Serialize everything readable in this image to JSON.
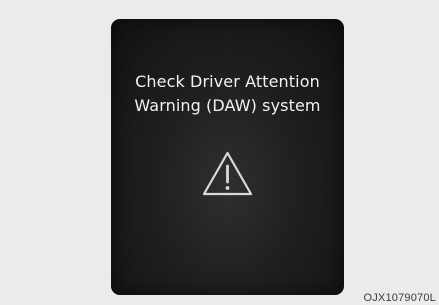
{
  "warning": {
    "line1": "Check Driver Attention",
    "line2": "Warning (DAW) system",
    "icon": "warning-triangle-icon"
  },
  "image_code": "OJX1079070L",
  "colors": {
    "background": "#ebebeb",
    "panel": "#1f1f1f",
    "text": "#f2f2f2",
    "icon": "#d9d9d9"
  }
}
